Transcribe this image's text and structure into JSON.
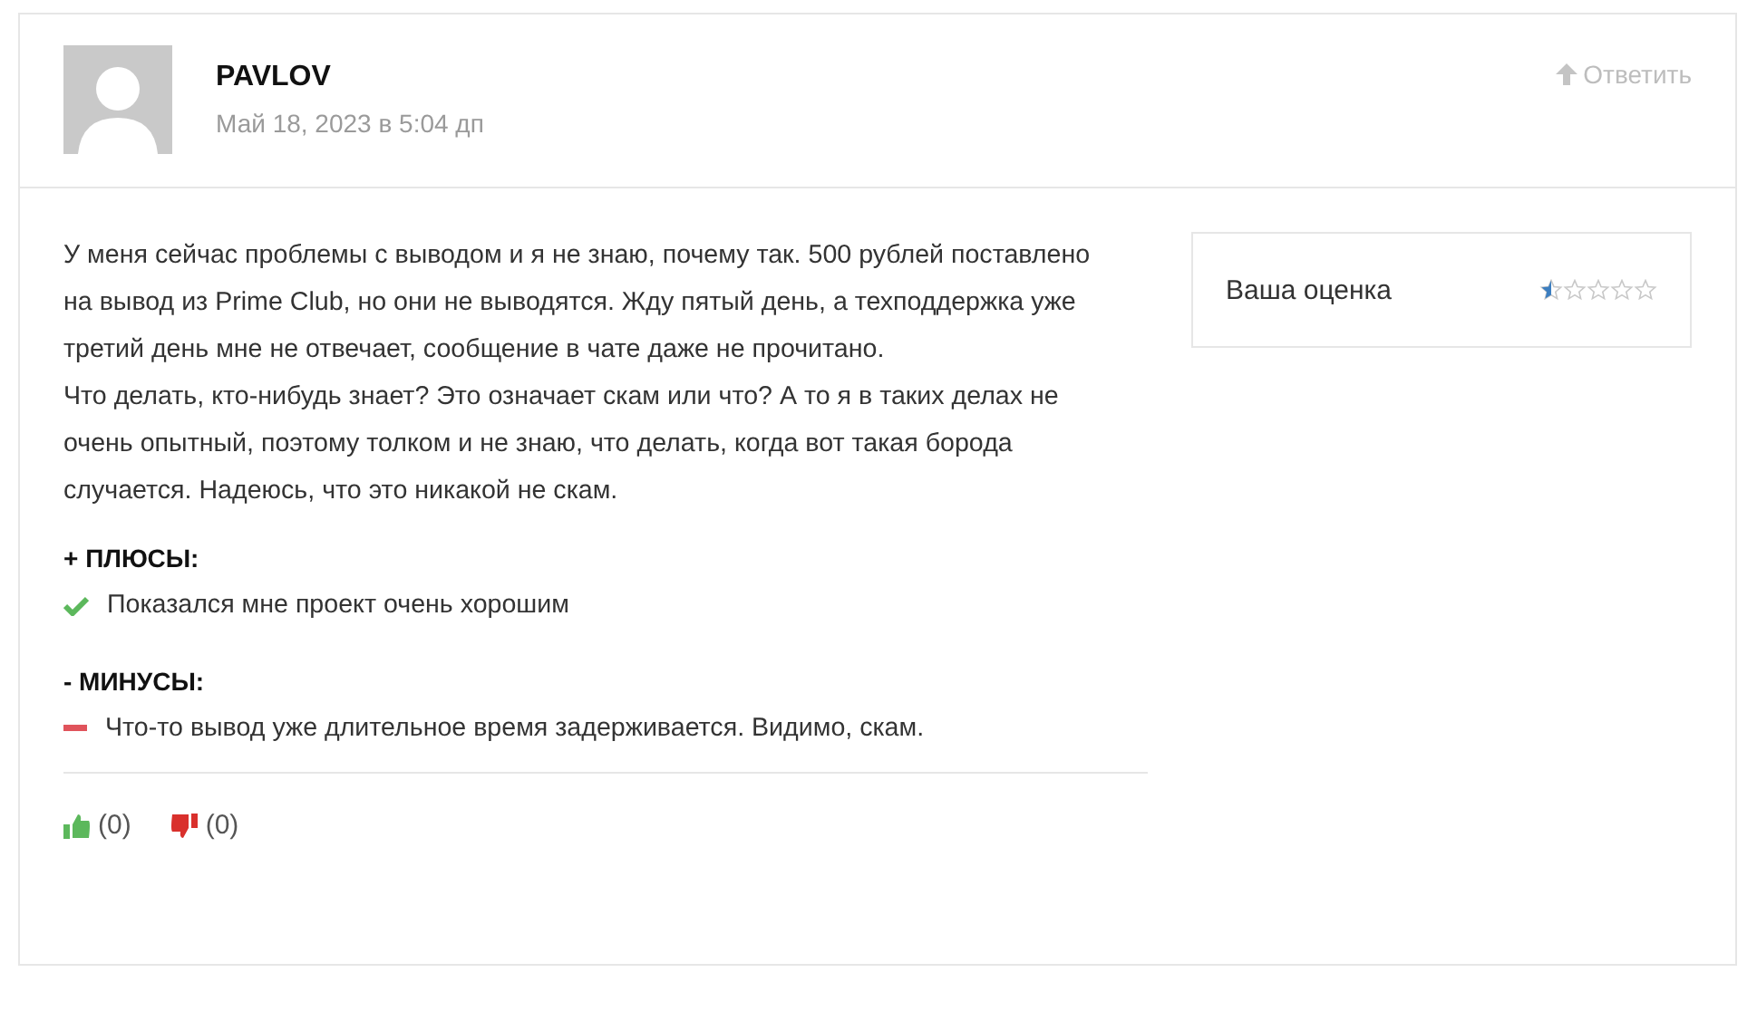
{
  "author": {
    "name": "PAVLOV",
    "date": "Май 18, 2023 в 5:04 дп"
  },
  "reply_link": {
    "label": "Ответить"
  },
  "body": [
    "У меня сейчас проблемы с выводом и я не знаю, почему так. 500 рублей поставлено на вывод из Prime Club, но они не выводятся. Жду пятый день, а техподдержка уже третий день мне не отвечает, сообщение в чате даже не прочитано.",
    "Что делать, кто-нибудь знает? Это означает скам или что? А то я в таких делах не очень опытный, поэтому толком и не знаю, что делать, когда вот такая борода случается. Надеюсь, что это никакой не скам."
  ],
  "pros": {
    "heading": "+ ПЛЮСЫ:",
    "items": [
      "Показался мне проект очень хорошим"
    ]
  },
  "cons": {
    "heading": "- МИНУСЫ:",
    "items": [
      "Что-то вывод уже длительное время задерживается. Видимо, скам."
    ]
  },
  "votes": {
    "likes": "(0)",
    "dislikes": "(0)"
  },
  "rating": {
    "label": "Ваша оценка",
    "stars": 0.5
  }
}
